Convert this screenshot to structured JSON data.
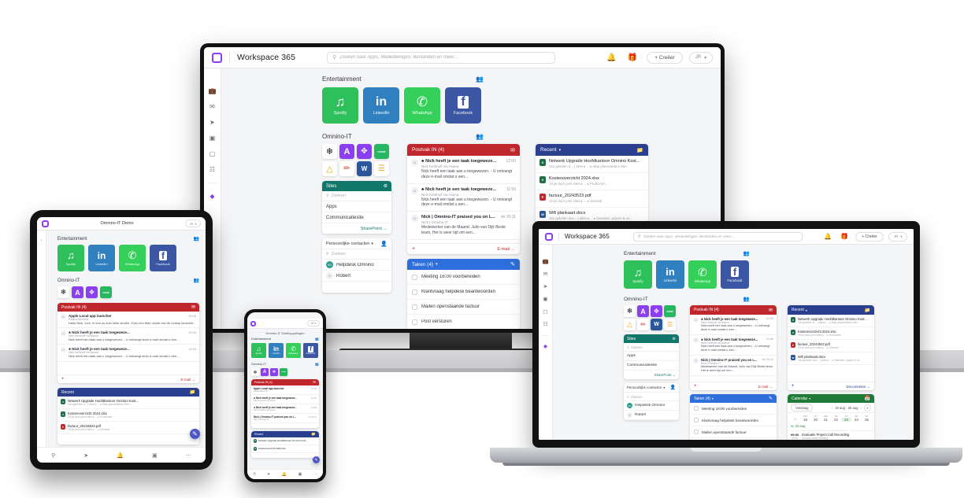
{
  "app": {
    "brand": "Workspace 365",
    "logo_icon": "workspace-square-logo",
    "search_placeholder": "Zoeken naar Apps, Mededelingen, Bestanden en meer...",
    "search_icon": "search-icon",
    "bell_icon": "bell-icon",
    "gift_icon": "gift-icon",
    "create_label": "+ Creëer",
    "avatar_initials": "JR",
    "chevron_icon": "chevron-down-icon",
    "accent": "#8b3ff0"
  },
  "rail": {
    "items": [
      {
        "name": "briefcase-icon",
        "glyph": "💼"
      },
      {
        "name": "mail-icon",
        "glyph": "✉"
      },
      {
        "name": "share-icon",
        "glyph": "➤"
      },
      {
        "name": "contacts-icon",
        "glyph": "▣"
      },
      {
        "name": "calendar-icon",
        "glyph": "▢"
      },
      {
        "name": "apps-grid-icon",
        "glyph": "☷"
      }
    ],
    "accent_item": {
      "name": "workspace-accent-icon",
      "glyph": "◆",
      "color": "#8b3ff0"
    }
  },
  "sections": {
    "entertainment": {
      "title": "Entertainment",
      "people_icon": "people-icon",
      "tiles": [
        {
          "label": "Spotify",
          "icon": "spotify-icon",
          "color": "#2ec05a"
        },
        {
          "label": "LinkedIn",
          "icon": "linkedin-icon",
          "color": "#3080c0"
        },
        {
          "label": "WhatsApp",
          "icon": "whatsapp-icon",
          "color": "#35d05a"
        },
        {
          "label": "Facebook",
          "icon": "facebook-icon",
          "color": "#3b57a3"
        }
      ]
    },
    "omnino": {
      "title": "Omnino-IT",
      "people_icon": "people-icon",
      "tiles": [
        {
          "label": "Asana",
          "icon": "asana-icon",
          "color": "#ffffff"
        },
        {
          "label": "Acrobat",
          "icon": "letter-a-icon",
          "color": "#8b3ff0"
        },
        {
          "label": "Compass",
          "icon": "compass-icon",
          "color": "#8b3ff0"
        },
        {
          "label": "Vexxt",
          "icon": "vexxt-icon",
          "color": "#26b860"
        },
        {
          "label": "Google Ads",
          "icon": "google-ads-icon",
          "color": "#ffffff"
        },
        {
          "label": "Pen",
          "icon": "pen-icon",
          "color": "#ffffff"
        },
        {
          "label": "Word",
          "icon": "word-icon",
          "color": "#2b579a"
        },
        {
          "label": "Charts",
          "icon": "bar-chart-icon",
          "color": "#ffffff"
        }
      ]
    }
  },
  "sites_panel": {
    "title": "Sites",
    "header_icon": "sites-icon",
    "header_color": "#11776b",
    "search_placeholder": "Zoeken",
    "search_icon": "search-icon",
    "rows": [
      "Apps",
      "Communicatiesite"
    ],
    "footer_link": "SharePoint  →"
  },
  "contacts_panel": {
    "title": "Persoonlijke contacten",
    "chevron_icon": "chevron-down-icon",
    "card_icon": "contact-card-icon",
    "search_placeholder": "Zoeken",
    "search_icon": "search-icon",
    "contacts": [
      {
        "name": "Helpdesk Omnino",
        "initials": "HO",
        "color": "#2a9d8f"
      },
      {
        "name": "Robert",
        "initials": "R",
        "color": "#f0f0f4"
      }
    ]
  },
  "inbox": {
    "title": "Postvak IN (4)",
    "header_color": "#c0272d",
    "header_icon": "envelope-icon",
    "footer_plus": "+",
    "footer_link": "E-mail  →",
    "emails": [
      {
        "subject": "♣ Nick heeft je een taak toegeweze...",
        "from": "Nick Kerkhoff via Asana",
        "preview": "Nick heeft een taak aan u toegewezen. - U ontvangt deze e-mail omdat u een...",
        "time": "12:00",
        "avatar": "N"
      },
      {
        "subject": "♣ Nick heeft je een taak toegeweze...",
        "from": "Nick Kerkhoff via Asana",
        "preview": "Nick heeft een taak aan u toegewezen. - U ontvangt deze e-mail omdat u een...",
        "time": "11:59",
        "avatar": "N"
      },
      {
        "subject": "Nick | Omnino-IT praised you on L...",
        "from": "Nick | Omnino-IT",
        "preview": "Medewerker van de Maand: Julio van Dijk Beste team, Het is weer tijd om een...",
        "time": "do 20:11",
        "avatar": "N"
      }
    ],
    "extra_email": {
      "subject": "Apple Local app launcher",
      "from": "Roland Beenink",
      "preview": "Hallo Nick, Jorn, Ik kon zo snel niets vinden. Over een Mac versie van de lookup launcher...",
      "time": "13:03",
      "avatar": "R"
    }
  },
  "recent": {
    "title": "Recent",
    "chevron_icon": "chevron-down-icon",
    "header_color": "#2b3f8f",
    "header_icon": "folder-icon",
    "footer_plus": "+",
    "footer_link": "Documenten  →",
    "docs": [
      {
        "name": "Netwerk Upgrade Hoofdkantoor Omnino Kost...",
        "meta": "16u geleden d... | sites ▸ ... ▸ Map placeholders Wer...",
        "type": "xlsx",
        "color": "#1d7044"
      },
      {
        "name": "Kostenoverzicht 2024.xlsx",
        "meta": "19 jul door jornl sites ▸ ... ▸ Producten",
        "type": "xlsx",
        "color": "#1d7044"
      },
      {
        "name": "factuur_20243523.pdf",
        "meta": "19 jul door jornl sites ▸ ... ▸ General",
        "type": "pdf",
        "color": "#c0272d"
      },
      {
        "name": "Wifi plankaart.docx",
        "meta": "16u geleden doc... | sites ▸ ... ▸ Diensten, prijzen & ov...",
        "type": "docx",
        "color": "#2b579a"
      }
    ]
  },
  "tasks": {
    "title": "Taken (4)",
    "chevron_icon": "chevron-down-icon",
    "header_color": "#2f6fdb",
    "header_icon": "pencil-icon",
    "items": [
      "Meeting 16:00 voorbereiden",
      "Klantvraag helpdesk beantwoorden",
      "Mailen openstaande factuur",
      "Post versturen"
    ]
  },
  "calendar": {
    "title": "Calendar",
    "chevron_icon": "chevron-down-icon",
    "header_color": "#1f7a37",
    "header_icon": "calendar-icon",
    "today_label": "Vandaag",
    "prev_icon": "chevron-left-icon",
    "next_icon": "chevron-right-icon",
    "expand_icon": "chevron-down-icon",
    "range": "19 aug - 25 aug",
    "day_headers": [
      "",
      "ma",
      "di",
      "wo",
      "do",
      "vr",
      "za",
      "zo"
    ],
    "week_number": "34",
    "days": [
      "19",
      "20",
      "21",
      "22",
      "23",
      "24",
      "25"
    ],
    "selected_day": "23",
    "day_label": "vr, 23 aug",
    "events": [
      {
        "start": "09:00",
        "end": "09:30",
        "name": "Evaluatie Project Call Recording",
        "sub": "Account team meeting"
      }
    ]
  },
  "devices": {
    "tablet": {
      "title": "Omnino-IT Demo",
      "avatar_initials": "JR"
    },
    "phone": {
      "title": "Omnino-IT  Snelkoppelingen",
      "avatar_initials": "JR"
    },
    "laptop": {
      "title": "Workspace 365"
    }
  },
  "bottom_nav": {
    "items": [
      {
        "name": "search-icon",
        "glyph": "🔍"
      },
      {
        "name": "share-icon",
        "glyph": "➤"
      },
      {
        "name": "bell-icon",
        "glyph": "🔔"
      },
      {
        "name": "bookmark-icon",
        "glyph": "▣"
      },
      {
        "name": "more-icon",
        "glyph": "⋯"
      }
    ]
  }
}
